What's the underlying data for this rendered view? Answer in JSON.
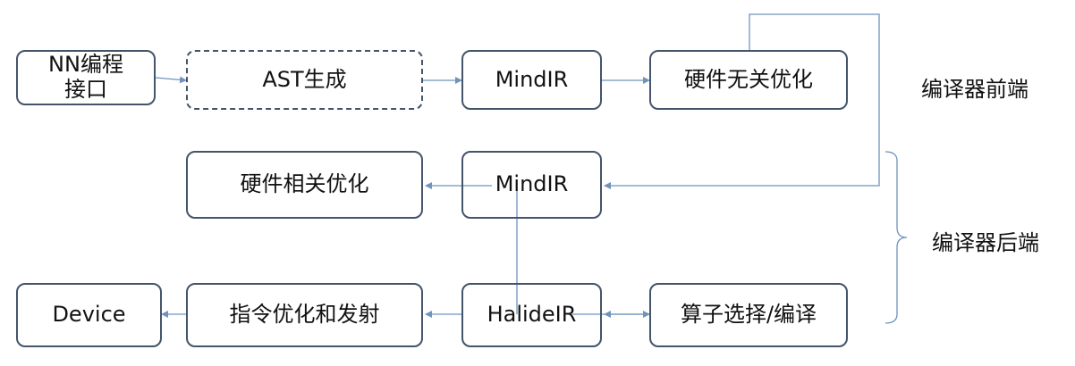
{
  "nodes": {
    "nn_api": "NN编程\n接口",
    "ast": "AST生成",
    "mindir_top": "MindIR",
    "hw_indep": "硬件无关优化",
    "hw_dep": "硬件相关优化",
    "mindir_mid": "MindIR",
    "device": "Device",
    "instr": "指令优化和发射",
    "halide": "HalideIR",
    "op_select": "算子选择/编译"
  },
  "labels": {
    "frontend": "编译器前端",
    "backend": "编译器后端"
  },
  "colors": {
    "box_border": "#44546a",
    "arrow": "#6f93bd"
  }
}
